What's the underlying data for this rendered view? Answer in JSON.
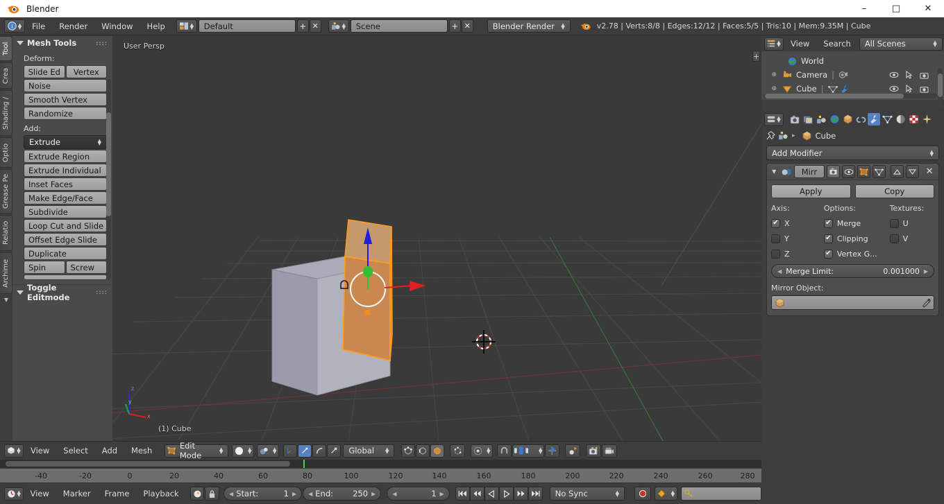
{
  "window": {
    "title": "Blender",
    "app_icon": "blender-logo-icon",
    "minimize": "–",
    "maximize": "□",
    "close": "✕"
  },
  "topbar": {
    "editor_icon": "info-editor-icon",
    "menus": [
      "File",
      "Render",
      "Window",
      "Help"
    ],
    "screen_layout_icon": "screen-layout-icon",
    "screen_layout": "Default",
    "add_label": "+",
    "remove_label": "✕",
    "scene_icon": "scene-icon",
    "scene": "Scene",
    "scene_add": "+",
    "scene_remove": "✕",
    "render_engine": "Blender Render",
    "status_icon": "blender-logo-icon",
    "status": "v2.78 | Verts:8/8 | Edges:12/12 | Faces:5/5 | Tris:10 | Mem:9.35M | Cube"
  },
  "toolshelf": {
    "vertical_tabs": [
      {
        "label": "Tool",
        "active": true
      },
      {
        "label": "Crea",
        "active": false
      },
      {
        "label": "Shading /",
        "active": false
      },
      {
        "label": "Optio",
        "active": false
      },
      {
        "label": "Grease Pe",
        "active": false
      },
      {
        "label": "Relatio",
        "active": false
      },
      {
        "label": "Archime",
        "active": false
      }
    ],
    "panel_title": "Mesh Tools",
    "deform_label": "Deform:",
    "deform_pair": [
      "Slide Ed",
      "Vertex"
    ],
    "deform_buttons": [
      "Noise",
      "Smooth Vertex",
      "Randomize"
    ],
    "add_label": "Add:",
    "add_selected": "Extrude",
    "add_buttons": [
      "Extrude Region",
      "Extrude Individual",
      "Inset Faces",
      "Make Edge/Face",
      "Subdivide",
      "Loop Cut and Slide",
      "Offset Edge Slide",
      "Duplicate"
    ],
    "spin_pair": [
      "Spin",
      "Screw"
    ],
    "toggle_panel_title": "Toggle Editmode"
  },
  "viewport": {
    "view_label": "User Persp",
    "object_label": "(1) Cube",
    "panel_toggle": "+",
    "axis_x": "x",
    "axis_y": "y",
    "axis_z": "z",
    "colors": {
      "background": "#3a3a3a",
      "selected_face": "#c88a4e",
      "selection_outline": "#ff9b20",
      "mesh_grey": "#9a9aa8",
      "axis_x": "#c3312f",
      "axis_y": "#3fa23f",
      "gizmo_x": "#e02020",
      "gizmo_y": "#30c030",
      "gizmo_z": "#2020d8"
    }
  },
  "viewport_header": {
    "editor_icon": "3d-view-editor-icon",
    "menus": [
      "View",
      "Select",
      "Add",
      "Mesh"
    ],
    "mode_icon": "edit-mode-icon",
    "mode": "Edit Mode",
    "shading_icon": "solid-shading-icon",
    "scene_mode_icon": "scene-display-icon",
    "manip_icons": [
      "manipulator-toggle-icon",
      "translate-manipulator-icon",
      "rotate-manipulator-icon",
      "scale-manipulator-icon"
    ],
    "orientation": "Global",
    "select_modes": [
      "vertex-select-icon",
      "edge-select-icon",
      "face-select-icon"
    ],
    "occlude_icon": "limit-selection-visible-icon",
    "pivot_icon": "pivot-point-icon",
    "snap_magnet_icon": "snap-magnet-icon",
    "snap_target_icon": "snap-target-icon",
    "snap_element_icon": "snap-element-icon",
    "proportional_icon": "proportional-edit-icon",
    "render_icon": "render-image-icon",
    "render_anim_icon": "render-animation-icon"
  },
  "outliner": {
    "editor_icon": "outliner-editor-icon",
    "menus": [
      "View",
      "Search"
    ],
    "display_mode": "All Scenes",
    "rows": [
      {
        "icon": "world-icon",
        "label": "World",
        "expandable": false,
        "restrict": []
      },
      {
        "icon": "camera-data-icon",
        "label": "Camera",
        "expandable": true,
        "data_icon": "camera-object-icon",
        "restrict": [
          "eye-icon",
          "cursor-arrow-icon",
          "camera-render-icon"
        ]
      },
      {
        "icon": "mesh-object-icon",
        "label": "Cube",
        "expandable": true,
        "data_icon": "mesh-data-icon",
        "modifier_icon": "wrench-icon",
        "restrict": [
          "eye-icon",
          "cursor-arrow-icon",
          "camera-render-icon"
        ]
      }
    ]
  },
  "properties": {
    "editor_icon": "properties-editor-icon",
    "tabs": [
      {
        "name": "render-tab",
        "icon": "camera-back-icon",
        "selected": false
      },
      {
        "name": "render-layers-tab",
        "icon": "images-icon",
        "selected": false
      },
      {
        "name": "scene-tab",
        "icon": "scene-icon",
        "selected": false
      },
      {
        "name": "world-tab",
        "icon": "world-icon",
        "selected": false
      },
      {
        "name": "object-tab",
        "icon": "cube-icon",
        "selected": false
      },
      {
        "name": "constraints-tab",
        "icon": "chain-icon",
        "selected": false
      },
      {
        "name": "modifiers-tab",
        "icon": "wrench-icon",
        "selected": true
      },
      {
        "name": "data-tab",
        "icon": "mesh-triangle-icon",
        "selected": false
      },
      {
        "name": "material-tab",
        "icon": "sphere-icon",
        "selected": false
      },
      {
        "name": "texture-tab",
        "icon": "checker-icon",
        "selected": false
      },
      {
        "name": "particles-tab",
        "icon": "particles-icon",
        "selected": false
      }
    ],
    "breadcrumb_pin_icon": "pin-icon",
    "breadcrumb_scene_icon": "scene-icon",
    "breadcrumb_sep": "▸",
    "breadcrumb_object_icon": "cube-icon",
    "breadcrumb_object": "Cube",
    "add_modifier": "Add Modifier",
    "modifier": {
      "collapse_icon": "expand-triangle-icon",
      "type_icon": "mirror-modifier-icon",
      "name": "Mirr",
      "toggle_icons": [
        "render-toggle-icon",
        "realtime-toggle-icon",
        "edit-mode-toggle-icon",
        "cage-toggle-icon"
      ],
      "move_up_icon": "move-up-icon",
      "move_down_icon": "move-down-icon",
      "delete_icon": "delete-x-icon",
      "apply": "Apply",
      "copy": "Copy",
      "axis_label": "Axis:",
      "axis": [
        {
          "label": "X",
          "checked": true
        },
        {
          "label": "Y",
          "checked": false
        },
        {
          "label": "Z",
          "checked": false
        }
      ],
      "options_label": "Options:",
      "options": [
        {
          "label": "Merge",
          "checked": true
        },
        {
          "label": "Clipping",
          "checked": true
        },
        {
          "label": "Vertex G...",
          "checked": true
        }
      ],
      "textures_label": "Textures:",
      "textures": [
        {
          "label": "U",
          "checked": false
        },
        {
          "label": "V",
          "checked": false
        }
      ],
      "merge_limit_label": "Merge Limit:",
      "merge_limit_value": "0.001000",
      "mirror_object_label": "Mirror Object:",
      "mirror_object_value": "",
      "mirror_object_icon": "cube-icon",
      "eyedropper_icon": "eyedropper-icon"
    }
  },
  "timeline": {
    "ticks": [
      "-40",
      "-20",
      "0",
      "20",
      "40",
      "60",
      "80",
      "100",
      "120",
      "140",
      "160",
      "180",
      "200",
      "220",
      "240",
      "260",
      "280"
    ],
    "editor_icon": "timeline-editor-icon",
    "menus": [
      "View",
      "Marker",
      "Frame",
      "Playback"
    ],
    "auto_key_icon": "record-clock-icon",
    "lock_icon": "lock-icon",
    "start_label": "Start:",
    "start_value": "1",
    "end_label": "End:",
    "end_value": "250",
    "current_frame": "1",
    "transport": [
      "jump-start-icon",
      "step-back-icon",
      "play-reverse-icon",
      "play-icon",
      "step-forward-icon",
      "jump-end-icon"
    ],
    "sync_mode": "No Sync",
    "record_icon": "record-icon",
    "keyframe_type_icon": "keyframe-diamond-icon",
    "keying_set_icon": "keying-set-icon",
    "keying_set_value": ""
  }
}
